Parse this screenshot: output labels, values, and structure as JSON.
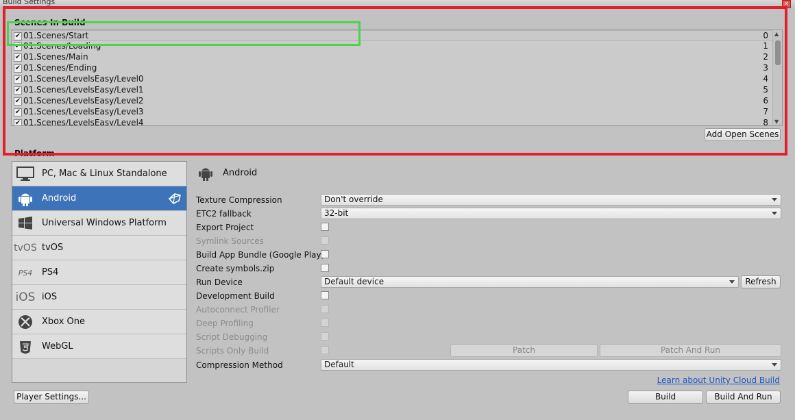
{
  "window": {
    "title": "Build Settings",
    "close_glyph": "×"
  },
  "scenes": {
    "header": "Scenes In Build",
    "items": [
      {
        "name": "01.Scenes/Start",
        "index": "0",
        "checked": true
      },
      {
        "name": "01.Scenes/Loading",
        "index": "1",
        "checked": true
      },
      {
        "name": "01.Scenes/Main",
        "index": "2",
        "checked": true
      },
      {
        "name": "01.Scenes/Ending",
        "index": "3",
        "checked": true
      },
      {
        "name": "01.Scenes/LevelsEasy/Level0",
        "index": "4",
        "checked": true
      },
      {
        "name": "01.Scenes/LevelsEasy/Level1",
        "index": "5",
        "checked": true
      },
      {
        "name": "01.Scenes/LevelsEasy/Level2",
        "index": "6",
        "checked": true
      },
      {
        "name": "01.Scenes/LevelsEasy/Level3",
        "index": "7",
        "checked": true
      },
      {
        "name": "01.Scenes/LevelsEasy/Level4",
        "index": "8",
        "checked": true
      }
    ],
    "add_open_scenes": "Add Open Scenes"
  },
  "platform": {
    "header": "Platform",
    "items": [
      {
        "label": "PC, Mac & Linux Standalone",
        "icon": "monitor-icon"
      },
      {
        "label": "Android",
        "icon": "android-icon",
        "selected": true
      },
      {
        "label": "Universal Windows Platform",
        "icon": "windows-icon"
      },
      {
        "label": "tvOS",
        "icon": "tvos-icon",
        "icon_text": "tvOS"
      },
      {
        "label": "PS4",
        "icon": "ps4-icon",
        "icon_text": "PS4"
      },
      {
        "label": "iOS",
        "icon": "ios-icon",
        "icon_text": "iOS"
      },
      {
        "label": "Xbox One",
        "icon": "xbox-icon"
      },
      {
        "label": "WebGL",
        "icon": "html5-icon"
      }
    ],
    "selected_title": "Android"
  },
  "settings": {
    "texture_compression": {
      "label": "Texture Compression",
      "value": "Don't override"
    },
    "etc2_fallback": {
      "label": "ETC2 fallback",
      "value": "32-bit"
    },
    "export_project": {
      "label": "Export Project"
    },
    "symlink_sources": {
      "label": "Symlink Sources"
    },
    "build_app_bundle": {
      "label": "Build App Bundle (Google Play)"
    },
    "create_symbols": {
      "label": "Create symbols.zip"
    },
    "run_device": {
      "label": "Run Device",
      "value": "Default device",
      "refresh": "Refresh"
    },
    "development_build": {
      "label": "Development Build"
    },
    "autoconnect_profiler": {
      "label": "Autoconnect Profiler"
    },
    "deep_profiling": {
      "label": "Deep Profiling"
    },
    "script_debugging": {
      "label": "Script Debugging"
    },
    "scripts_only_build": {
      "label": "Scripts Only Build",
      "patch": "Patch",
      "patch_and_run": "Patch And Run"
    },
    "compression_method": {
      "label": "Compression Method",
      "value": "Default"
    }
  },
  "footer": {
    "cloud_link": "Learn about Unity Cloud Build",
    "player_settings": "Player Settings...",
    "build": "Build",
    "build_and_run": "Build And Run"
  },
  "colors": {
    "selected_platform": "#3d74b9",
    "highlight_red": "#e0202c",
    "highlight_green": "#4cd24c",
    "link": "#1a55c0"
  }
}
